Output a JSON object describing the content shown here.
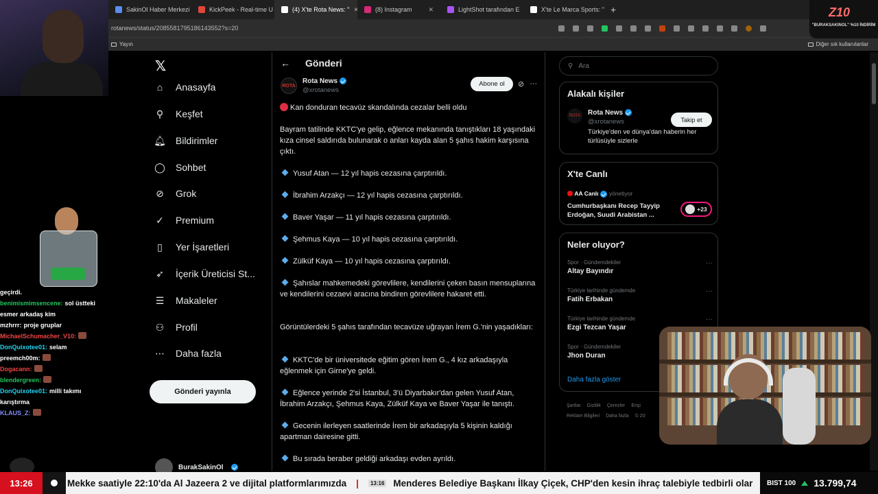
{
  "browser": {
    "tabs": [
      {
        "label": "SakinOl Haber Merkezi",
        "color": "#5a8dee"
      },
      {
        "label": "KickPeek - Real-time U",
        "color": "#e0463a"
      },
      {
        "label": "(4) X'te Rota News: \"",
        "color": "#ffffff"
      },
      {
        "label": "(8) Instagram",
        "color": "#d62976"
      },
      {
        "label": "LightShot tarafından E",
        "color": "#a855f7"
      },
      {
        "label": "X'te Le Marca Sports: \"",
        "color": "#ffffff"
      }
    ],
    "active_tab": 2,
    "url": "rotanews/status/2085581795186143552?s=20",
    "bookmark": "Yayın",
    "other_bookmarks": "Diğer sık kullanılanlar"
  },
  "nav": {
    "items": [
      {
        "label": "Anasayfa",
        "icon": "home-icon"
      },
      {
        "label": "Keşfet",
        "icon": "search-icon"
      },
      {
        "label": "Bildirimler",
        "icon": "bell-icon"
      },
      {
        "label": "Sohbet",
        "icon": "chat-icon"
      },
      {
        "label": "Grok",
        "icon": "grok-icon"
      },
      {
        "label": "Premium",
        "icon": "premium-icon"
      },
      {
        "label": "Yer İşaretleri",
        "icon": "bookmark-icon"
      },
      {
        "label": "İçerik Üreticisi St...",
        "icon": "rocket-icon"
      },
      {
        "label": "Makaleler",
        "icon": "article-icon"
      },
      {
        "label": "Profil",
        "icon": "profile-icon"
      },
      {
        "label": "Daha fazla",
        "icon": "more-icon"
      }
    ],
    "post_button": "Gönderi yayınla",
    "account_name": "BurakSakinOl"
  },
  "post": {
    "header": "Gönderi",
    "author": "Rota News",
    "handle": "@xrotanews",
    "subscribe": "Abone ol",
    "title": "Kan donduran tecavüz skandalında cezalar belli oldu",
    "intro": "Bayram tatilinde KKTC'ye gelip, eğlence mekanında tanıştıkları 18 yaşındaki kıza cinsel saldırıda bulunarak o anları kayda alan 5 şahıs hakim karşısına çıktı.",
    "sentences": [
      "Yusuf Atan — 12 yıl hapis cezasına çarptırıldı.",
      "İbrahim Arzakçı — 12 yıl hapis cezasına çarptırıldı.",
      "Baver Yaşar — 11 yıl hapis cezasına çarptırıldı.",
      "Şehmus Kaya — 10 yıl hapis cezasına çarptırıldı.",
      "Zülküf Kaya — 10 yıl hapis cezasına çarptırıldı.",
      "Şahıslar mahkemedeki görevlilere, kendilerini çeken basın mensuplarına ve kendilerini cezaevi aracına bindiren görevlilere hakaret etti."
    ],
    "section_intro": "Görüntülerdeki 5 şahıs tarafından tecavüze uğrayan İrem G.'nin yaşadıkları:",
    "details": [
      "KKTC'de bir üniversitede eğitim gören İrem G., 4 kız arkadaşıyla eğlenmek için Girne'ye geldi.",
      "Eğlence yerinde 2'si İstanbul, 3'ü Diyarbakır'dan gelen Yusuf Atan, İbrahim Arzakçı, Şehmus Kaya, Zülküf Kaya ve Baver Yaşar ile tanıştı.",
      "Gecenin ilerleyen saatlerinde İrem bir arkadaşıyla 5 kişinin kaldığı apartman dairesine gitti.",
      "Bu sırada beraber geldiği arkadaşı evden ayrıldı."
    ]
  },
  "sidebar": {
    "search_placeholder": "Ara",
    "related_title": "Alakalı kişiler",
    "related": {
      "name": "Rota News",
      "handle": "@xrotanews",
      "bio": "Türkiye'den ve dünya'dan haberin her türlüsüyle sizlerle",
      "follow": "Takip et"
    },
    "live_title": "X'te Canlı",
    "live": {
      "source": "AA Canlı",
      "action": "yönetiyor",
      "text": "Cumhurbaşkanı Recep Tayyip Erdoğan, Suudi Arabistan ...",
      "count": "+23"
    },
    "trends_title": "Neler oluyor?",
    "trends": [
      {
        "meta": "Spor · Gündemdekiler",
        "title": "Altay Bayındır"
      },
      {
        "meta": "Türkiye tarihinde gündemde",
        "title": "Fatih Erbakan"
      },
      {
        "meta": "Türkiye tarihinde gündemde",
        "title": "Ezgi Tezcan Yaşar"
      },
      {
        "meta": "Spor · Gündemdekiler",
        "title": "Jhon Duran"
      }
    ],
    "show_more": "Daha fazla göster",
    "footer": [
      "Şartlar",
      "Gizlilik",
      "Çerezler",
      "Erişi",
      "Reklam Bilgileri",
      "Daha fazla",
      "© 20"
    ]
  },
  "chat": {
    "messages": [
      {
        "user": "",
        "text": "geçirdi.",
        "color": "#ffffff"
      },
      {
        "user": "benimismimsencene:",
        "text": "sol üstteki esmer arkadaş kim",
        "color": "#22c55e"
      },
      {
        "user": "mzhrrr:",
        "text": "proje gruplar",
        "color": "#ffffff"
      },
      {
        "user": "MichaelSchumacher_V10:",
        "text": "",
        "color": "#ef4444"
      },
      {
        "user": "DonQuixotee01:",
        "text": "selam",
        "color": "#22d3ee"
      },
      {
        "user": "preemch00m:",
        "text": "",
        "color": "#ffffff"
      },
      {
        "user": "Dogacann:",
        "text": "",
        "color": "#ef4444"
      },
      {
        "user": "blendergreen:",
        "text": "",
        "color": "#22c55e"
      },
      {
        "user": "DonQuixotee01:",
        "text": "milli takımı karıştırma",
        "color": "#22d3ee"
      },
      {
        "user": "KLAUS_Z:",
        "text": "",
        "color": "#818cf8"
      }
    ]
  },
  "overlay": {
    "brand": "Z10",
    "brand_text": "\"BURAKSAKINOL\" %10 İNDİRİM"
  },
  "ticker": {
    "time": "13:26",
    "text1": "Mekke saatiyle 22:10'da Al Jazeera 2 ve dijital platformlarımızda",
    "sep": "|",
    "stamp": "13:16",
    "text2": "Menderes Belediye Başkanı İlkay Çiçek, CHP'den kesin ihraç talebiyle tedbirli olar",
    "bist_label": "BIST 100",
    "bist_value": "13.799,74"
  }
}
